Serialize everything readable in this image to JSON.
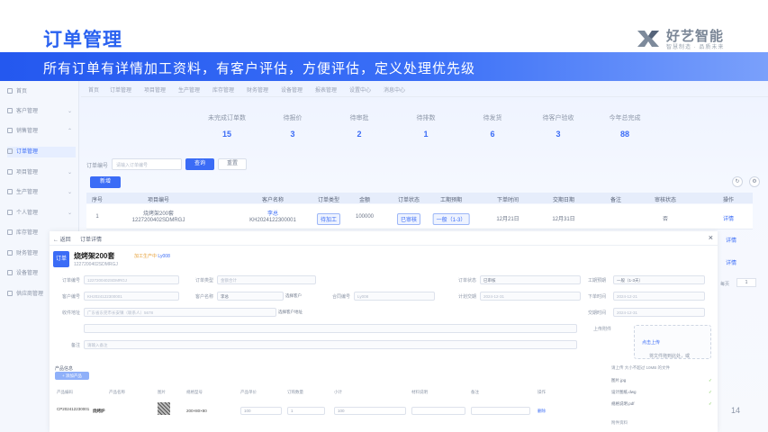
{
  "slide": {
    "title": "订单管理",
    "subtitle": "所有订单有详情加工资料，有客户评估，方便评估，定义处理优先级",
    "page_number": "14",
    "brand": "好艺智能",
    "slogan": "智慧制造 · 品质未来"
  },
  "sidebar": {
    "items": [
      {
        "label": "首页"
      },
      {
        "label": "客户管理"
      },
      {
        "label": "销售管理"
      },
      {
        "label": "订单管理"
      },
      {
        "label": "项目管理"
      },
      {
        "label": "生产管理"
      },
      {
        "label": "个人管理"
      },
      {
        "label": "库存管理"
      },
      {
        "label": "财务管理"
      },
      {
        "label": "设备管理"
      },
      {
        "label": "供应商管理"
      }
    ]
  },
  "topnav": {
    "items": [
      "首页",
      "订单管理",
      "项目管理",
      "生产管理",
      "库存管理",
      "财务管理",
      "设备管理",
      "报表管理",
      "设置中心",
      "消息中心"
    ]
  },
  "stats": [
    {
      "label": "未完成订单数",
      "value": "15"
    },
    {
      "label": "待报价",
      "value": "3"
    },
    {
      "label": "待审批",
      "value": "2"
    },
    {
      "label": "待排数",
      "value": "1"
    },
    {
      "label": "待发货",
      "value": "6"
    },
    {
      "label": "待客户验收",
      "value": "3"
    },
    {
      "label": "今年总完成",
      "value": "88"
    }
  ],
  "search": {
    "label": "订单编号",
    "placeholder": "请输入订单编号",
    "query": "查询",
    "reset": "重置",
    "add": "新增"
  },
  "table": {
    "headers": [
      "序号",
      "项目编号",
      "客户名称",
      "订单类型",
      "金额",
      "订单状态",
      "工期预期",
      "下单时间",
      "交期日期",
      "备注",
      "审核状态",
      "操作"
    ],
    "row": {
      "index": "1",
      "project_name": "烧烤架200套",
      "project_code": "1227200402SDMRGJ",
      "customer": "李总",
      "customer_code": "KH2024122300001",
      "type": "待加工",
      "amount": "100000",
      "status": "已审核",
      "priority": "一般（1-3）",
      "order_date": "12月21日",
      "due_date": "12月31日",
      "note": "",
      "audit": "否",
      "op": "详情"
    },
    "side_links": [
      "详情",
      "详情"
    ]
  },
  "pagination": {
    "per": "每页",
    "page": "1"
  },
  "detail": {
    "back": "← 返回",
    "title": "订单详情",
    "badge": "订单",
    "name": "烧烤架200套",
    "status": "加工生产中",
    "tag": "Ly008",
    "code": "1227200402SDMRGJ",
    "fields": [
      {
        "label": "订单编号",
        "value": "1227200402SDMRGJ"
      },
      {
        "label": "订单类型",
        "value": "金额合计"
      },
      {
        "label": "工期预期",
        "value": "一般（1-3天）"
      },
      {
        "label": "订单状态",
        "value": "已审核"
      },
      {
        "label": "客户编号",
        "value": "KH2024122300001"
      },
      {
        "label": "客户名称",
        "value": "李总"
      },
      {
        "label": "计划交期",
        "value": "2024-12-31"
      },
      {
        "label": "下单时间",
        "value": "2024-12-21"
      },
      {
        "label": "收件地址",
        "value": "广东省东莞市长安镇（联系人）5678"
      },
      {
        "label": "交期时间",
        "value": "2024-12-31"
      },
      {
        "label": "合同编号",
        "value": "Ly008"
      },
      {
        "label": "备注",
        "value": "请输入备注"
      }
    ],
    "choose_customer": "选择客户",
    "choose_address": "选择客户地址",
    "upload_label": "上传附件",
    "upload_text": "将文件拖到此处，或",
    "upload_link": "点击上传",
    "upload_hint": "请上传 大小不超过 10MB 的文件",
    "files": [
      "图片.jpg",
      "设计图纸.dwg",
      "规格说明.pdf"
    ],
    "product_section": "产品信息",
    "add_product": "+ 添加产品",
    "product_headers": [
      "产品编码",
      "产品名称",
      "图片",
      "规格型号",
      "产品单价",
      "订购数量",
      "小计",
      "材料说明",
      "备注",
      "操作"
    ],
    "product_row": {
      "code": "CP202412230001",
      "name": "烧烤炉",
      "spec": "200×80×80",
      "price": "100",
      "qty": "1",
      "subtotal": "100",
      "op": "删除"
    },
    "attachment_label": "附件资料"
  }
}
